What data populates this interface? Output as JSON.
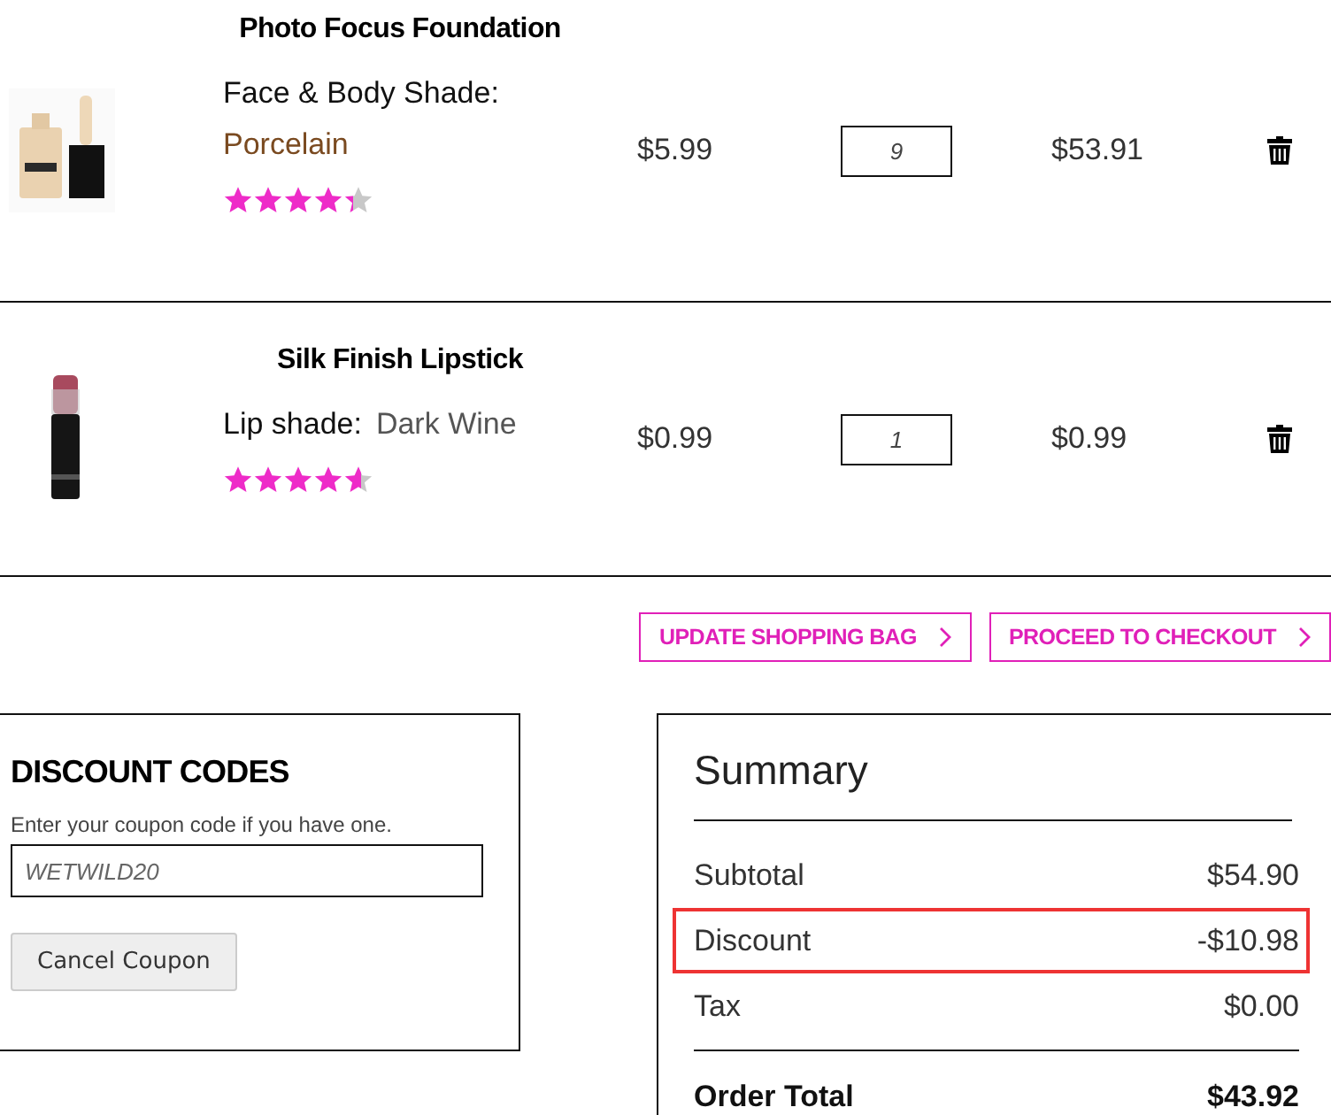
{
  "cart_items": [
    {
      "name": "Photo Focus Foundation",
      "option_label": "Face & Body Shade:",
      "option_value": "Porcelain",
      "stars": 4.3,
      "price": "$5.99",
      "quantity": "9",
      "subtotal": "$53.91"
    },
    {
      "name": "Silk Finish Lipstick",
      "option_label": "Lip shade:",
      "option_value": "Dark Wine",
      "stars": 4.6,
      "price": "$0.99",
      "quantity": "1",
      "subtotal": "$0.99"
    }
  ],
  "actions": [
    "UPDATE SHOPPING BAG",
    "PROCEED TO CHECKOUT"
  ],
  "discount": {
    "title": "DISCOUNT CODES",
    "hint": "Enter your coupon code if you have one.",
    "code": "WETWILD20",
    "button": "Cancel Coupon"
  },
  "summary": {
    "title": "Summary",
    "rows": [
      {
        "label": "Subtotal",
        "value": "$54.90",
        "highlighted": false
      },
      {
        "label": "Discount",
        "value": "-$10.98",
        "highlighted": true
      },
      {
        "label": "Tax",
        "value": "$0.00",
        "highlighted": false
      }
    ],
    "total_label": "Order Total",
    "total_value": "$43.92"
  }
}
